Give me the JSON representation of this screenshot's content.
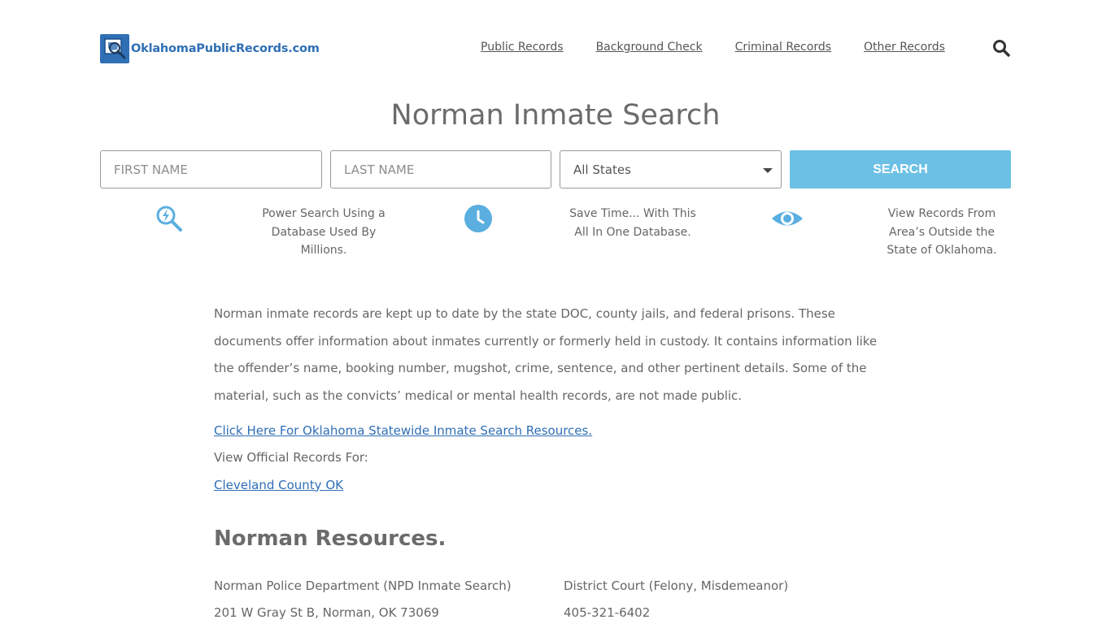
{
  "header": {
    "logo_text": "OklahomaPublicRecords.com",
    "nav": [
      "Public Records",
      "Background Check",
      "Criminal Records",
      "Other Records"
    ]
  },
  "page_title": "Norman Inmate Search",
  "search": {
    "first_placeholder": "FIRST NAME",
    "last_placeholder": "LAST NAME",
    "state_value": "All States",
    "button_label": "SEARCH"
  },
  "features": [
    {
      "icon": "power-search-icon",
      "text": "Power Search Using a Database Used By Millions."
    },
    {
      "icon": "clock-icon",
      "text": "Save Time... With This All In One Database."
    },
    {
      "icon": "eye-icon",
      "text": "View Records From Area’s Outside the State of Oklahoma."
    }
  ],
  "content": {
    "intro": "Norman inmate records are kept up to date by the state DOC, county jails, and federal prisons. These documents offer information about inmates currently or formerly held in custody. It contains information like the offender’s name, booking number, mugshot, crime, sentence, and other pertinent details. Some of the material, such as the convicts’ medical or mental health records, are not made public.",
    "statewide_link": "Click Here For Oklahoma Statewide Inmate Search Resources.",
    "view_official": "View Official Records For:",
    "county_link": "Cleveland County OK"
  },
  "resources": {
    "title": "Norman Resources.",
    "col1": {
      "name": "Norman Police Department (NPD Inmate Search)",
      "address": "201 W Gray St B, Norman, OK 73069"
    },
    "col2": {
      "name": "District Court (Felony, Misdemeanor)",
      "phone": "405-321-6402"
    }
  },
  "colors": {
    "brand": "#2f6fb5",
    "button": "#6cc0e5",
    "icon": "#5aaee0"
  }
}
